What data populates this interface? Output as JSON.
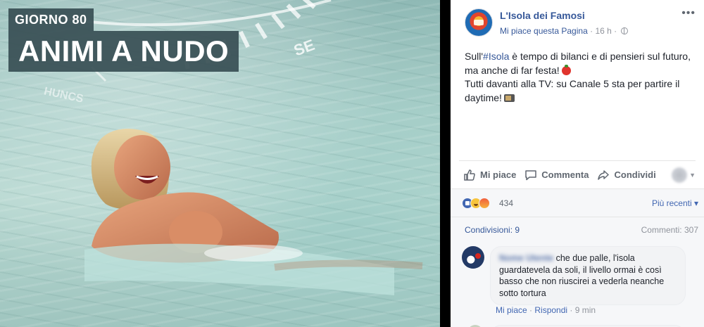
{
  "photo": {
    "day_label": "GIORNO 80",
    "title": "ANIMI A NUDO"
  },
  "post": {
    "page_name": "L'Isola dei Famosi",
    "like_page": "Mi piace questa Pagina",
    "time": "16 h",
    "text_prefix": "Sull'",
    "hashtag": "#Isola",
    "text_line1_rest": " è tempo di bilanci e di pensieri sul futuro, ma anche di far festa!",
    "text_line2": "Tutti davanti alla TV: su Canale 5 sta per partire il daytime!"
  },
  "actions": {
    "like": "Mi piace",
    "comment": "Commenta",
    "share": "Condividi"
  },
  "reactions": {
    "count": "434",
    "sort_label": "Più recenti ▾"
  },
  "stats": {
    "shares": "Condivisioni: 9",
    "comments": "Commenti: 307"
  },
  "comment": {
    "author": "Nome Utente",
    "text_line1": "che due palle, l'isola guardatevela da soli, il livello ormai è così basso che non riuscirei a vederla neanche sotto tortura",
    "like": "Mi piace",
    "reply": "Rispondi",
    "time": "9 min"
  }
}
